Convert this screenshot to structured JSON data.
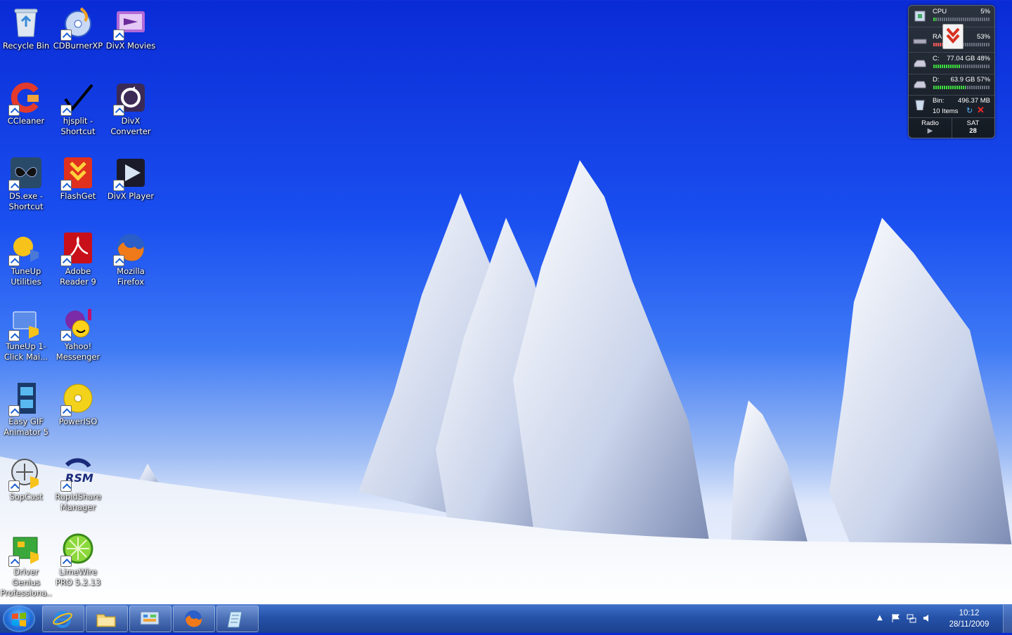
{
  "desktop": {
    "icons": [
      {
        "label": "Recycle Bin",
        "icon": "recycle-bin-icon",
        "shortcut": false
      },
      {
        "label": "CDBurnerXP",
        "icon": "cd-burner-icon",
        "shortcut": true
      },
      {
        "label": "DivX Movies",
        "icon": "divx-movies-icon",
        "shortcut": true
      },
      {
        "label": "CCleaner",
        "icon": "ccleaner-icon",
        "shortcut": true
      },
      {
        "label": "hjsplit - Shortcut",
        "icon": "checkmark-icon",
        "shortcut": true
      },
      {
        "label": "DivX Converter",
        "icon": "divx-converter-icon",
        "shortcut": true
      },
      {
        "label": "DS.exe - Shortcut",
        "icon": "butterfly-icon",
        "shortcut": true
      },
      {
        "label": "FlashGet",
        "icon": "flashget-icon",
        "shortcut": true
      },
      {
        "label": "DivX Player",
        "icon": "divx-player-icon",
        "shortcut": true
      },
      {
        "label": "TuneUp Utilities",
        "icon": "tuneup-icon",
        "shortcut": true
      },
      {
        "label": "Adobe Reader 9",
        "icon": "adobe-reader-icon",
        "shortcut": true
      },
      {
        "label": "Mozilla Firefox",
        "icon": "firefox-icon",
        "shortcut": true
      },
      {
        "label": "TuneUp 1-Click Mai...",
        "icon": "tuneup-oneclick-icon",
        "shortcut": true
      },
      {
        "label": "Yahoo! Messenger",
        "icon": "yahoo-messenger-icon",
        "shortcut": true
      },
      {
        "label": "Easy GIF Animator 5",
        "icon": "film-strip-icon",
        "shortcut": true
      },
      {
        "label": "PowerISO",
        "icon": "poweriso-disc-icon",
        "shortcut": true
      },
      {
        "label": "SopCast",
        "icon": "sopcast-icon",
        "shortcut": true
      },
      {
        "label": "RapidShare Manager",
        "icon": "rsm-icon",
        "shortcut": true
      },
      {
        "label": "Driver Genius Professiona...",
        "icon": "driver-genius-icon",
        "shortcut": true
      },
      {
        "label": "LimeWire PRO 5.2.13",
        "icon": "limewire-icon",
        "shortcut": true
      }
    ]
  },
  "gadget": {
    "cpu": {
      "label": "CPU",
      "value": "5%",
      "percent": 5
    },
    "ram": {
      "label": "RA",
      "value": "53%",
      "percent": 53
    },
    "drive_c": {
      "label": "C:",
      "value": "77.04 GB 48%",
      "percent": 48
    },
    "drive_d": {
      "label": "D:",
      "value": "63.9 GB 57%",
      "percent": 57
    },
    "bin": {
      "label": "Bin:",
      "size": "496.37 MB",
      "items": "10 Items"
    },
    "radio": {
      "label": "Radio"
    },
    "calendar": {
      "day": "SAT",
      "date": "28"
    }
  },
  "taskbar": {
    "pinned": [
      {
        "name": "internet-explorer-icon"
      },
      {
        "name": "file-explorer-icon"
      },
      {
        "name": "control-panel-icon"
      },
      {
        "name": "firefox-icon"
      },
      {
        "name": "notepad-icon"
      }
    ],
    "clock": {
      "time": "10:12",
      "date": "28/11/2009"
    }
  },
  "colors": {
    "accent": "#1a4ff0",
    "taskbar": "#2552a8"
  }
}
